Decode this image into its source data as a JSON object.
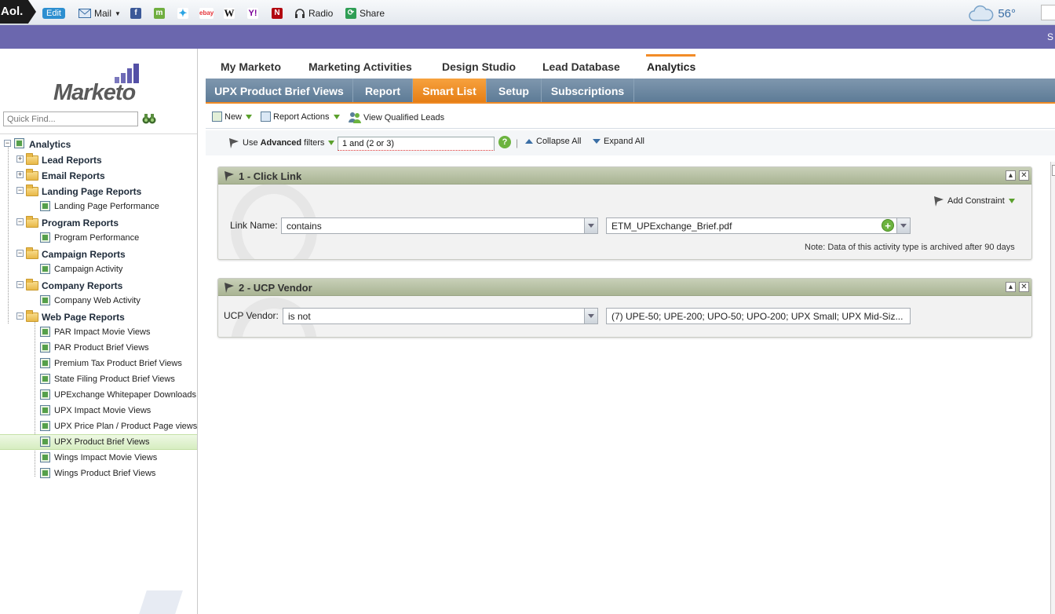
{
  "aolbar": {
    "logo": "Aol.",
    "edit": "Edit",
    "mail": "Mail",
    "radio": "Radio",
    "share": "Share",
    "temperature": "56°",
    "icons": [
      "facebook-icon",
      "myspace-icon",
      "twitter-icon",
      "ebay-icon",
      "wikipedia-icon",
      "yahoo-icon",
      "netflix-icon"
    ]
  },
  "purple_band": {
    "text": "S"
  },
  "sidebar": {
    "logo_text": "Marketo",
    "quick_find_placeholder": "Quick Find...",
    "tree": [
      {
        "label": "Analytics",
        "type": "root"
      },
      {
        "label": "Lead Reports",
        "type": "folder",
        "expanded": false
      },
      {
        "label": "Email Reports",
        "type": "folder",
        "expanded": false
      },
      {
        "label": "Landing Page Reports",
        "type": "folder",
        "expanded": true
      },
      {
        "label": "Landing Page Performance",
        "type": "report"
      },
      {
        "label": "Program Reports",
        "type": "folder",
        "expanded": true
      },
      {
        "label": "Program Performance",
        "type": "report"
      },
      {
        "label": "Campaign Reports",
        "type": "folder",
        "expanded": true
      },
      {
        "label": "Campaign Activity",
        "type": "report"
      },
      {
        "label": "Company Reports",
        "type": "folder",
        "expanded": true
      },
      {
        "label": "Company Web Activity",
        "type": "report"
      },
      {
        "label": "Web Page Reports",
        "type": "folder",
        "expanded": true
      },
      {
        "label": "PAR Impact Movie Views",
        "type": "report"
      },
      {
        "label": "PAR Product Brief Views",
        "type": "report"
      },
      {
        "label": "Premium Tax Product Brief Views",
        "type": "report"
      },
      {
        "label": "State Filing Product Brief Views",
        "type": "report"
      },
      {
        "label": "UPExchange Whitepaper Downloads",
        "type": "report"
      },
      {
        "label": "UPX Impact Movie Views",
        "type": "report"
      },
      {
        "label": "UPX Price Plan / Product Page views",
        "type": "report"
      },
      {
        "label": "UPX Product Brief Views",
        "type": "report",
        "selected": true
      },
      {
        "label": "Wings Impact Movie Views",
        "type": "report"
      },
      {
        "label": "Wings Product Brief Views",
        "type": "report"
      }
    ]
  },
  "topnav": {
    "items": [
      "My Marketo",
      "Marketing Activities",
      "Design Studio",
      "Lead Database",
      "Analytics"
    ],
    "active": "Analytics"
  },
  "subnav": {
    "tabs": [
      "UPX Product Brief Views",
      "Report",
      "Smart List",
      "Setup",
      "Subscriptions"
    ],
    "active": "Smart List"
  },
  "actionbar": {
    "new": "New",
    "report_actions": "Report Actions",
    "view_qualified_leads": "View Qualified Leads"
  },
  "filterbar": {
    "use_label": "Use",
    "advanced_label": "Advanced",
    "filters_label": "filters",
    "expression": "1 and (2 or 3)",
    "help": "?",
    "collapse_all": "Collapse All",
    "expand_all": "Expand All"
  },
  "filters": [
    {
      "title": "1 - Click Link",
      "add_constraint": "Add Constraint",
      "field_label": "Link Name:",
      "operator": "contains",
      "value": "ETM_UPExchange_Brief.pdf",
      "note": "Note: Data of this activity type is archived after 90 days"
    },
    {
      "title": "2 - UCP Vendor",
      "field_label": "UCP Vendor:",
      "operator": "is not",
      "value": "(7) UPE-50; UPE-200; UPO-50; UPO-200; UPX Small; UPX Mid-Siz..."
    }
  ],
  "colors": {
    "purple_band": "#6b67ae",
    "active_tab": "#e57e16",
    "subnav": "#5d7b96",
    "panel_header": "#a9b493",
    "selected_row": "#d6edc0"
  }
}
